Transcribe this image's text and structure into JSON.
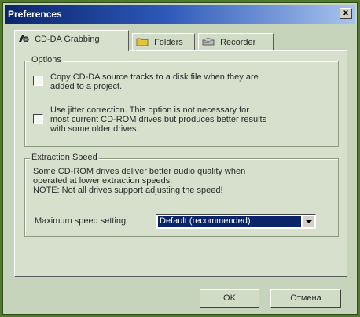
{
  "window": {
    "title": "Preferences",
    "close_glyph": "x"
  },
  "tabs": [
    {
      "label": "CD-DA Grabbing",
      "icon": "cd-grab-icon",
      "active": true
    },
    {
      "label": "Folders",
      "icon": "folder-icon",
      "active": false
    },
    {
      "label": "Recorder",
      "icon": "recorder-icon",
      "active": false
    }
  ],
  "options": {
    "title": "Options",
    "copy_tracks": {
      "line1": "Copy CD-DA source tracks to a disk file when they are",
      "line2": "added to a project.",
      "checked": false
    },
    "jitter": {
      "line1": "Use jitter correction. This option is not necessary for",
      "line2": "most current CD-ROM drives but produces better results",
      "line3": "with some older drives.",
      "checked": false
    }
  },
  "extraction": {
    "title": "Extraction Speed",
    "note1": "Some CD-ROM drives deliver better audio quality when",
    "note2": "operated at lower extraction speeds.",
    "note3": "NOTE: Not all drives support adjusting the speed!",
    "max_speed_label": "Maximum speed setting:",
    "max_speed_value": "Default (recommended)"
  },
  "buttons": {
    "ok": "OK",
    "cancel": "Отмена"
  },
  "colors": {
    "accent": "#0a246a",
    "window_bg": "#d6e0cc",
    "frame_green": "#4f7a2c"
  }
}
